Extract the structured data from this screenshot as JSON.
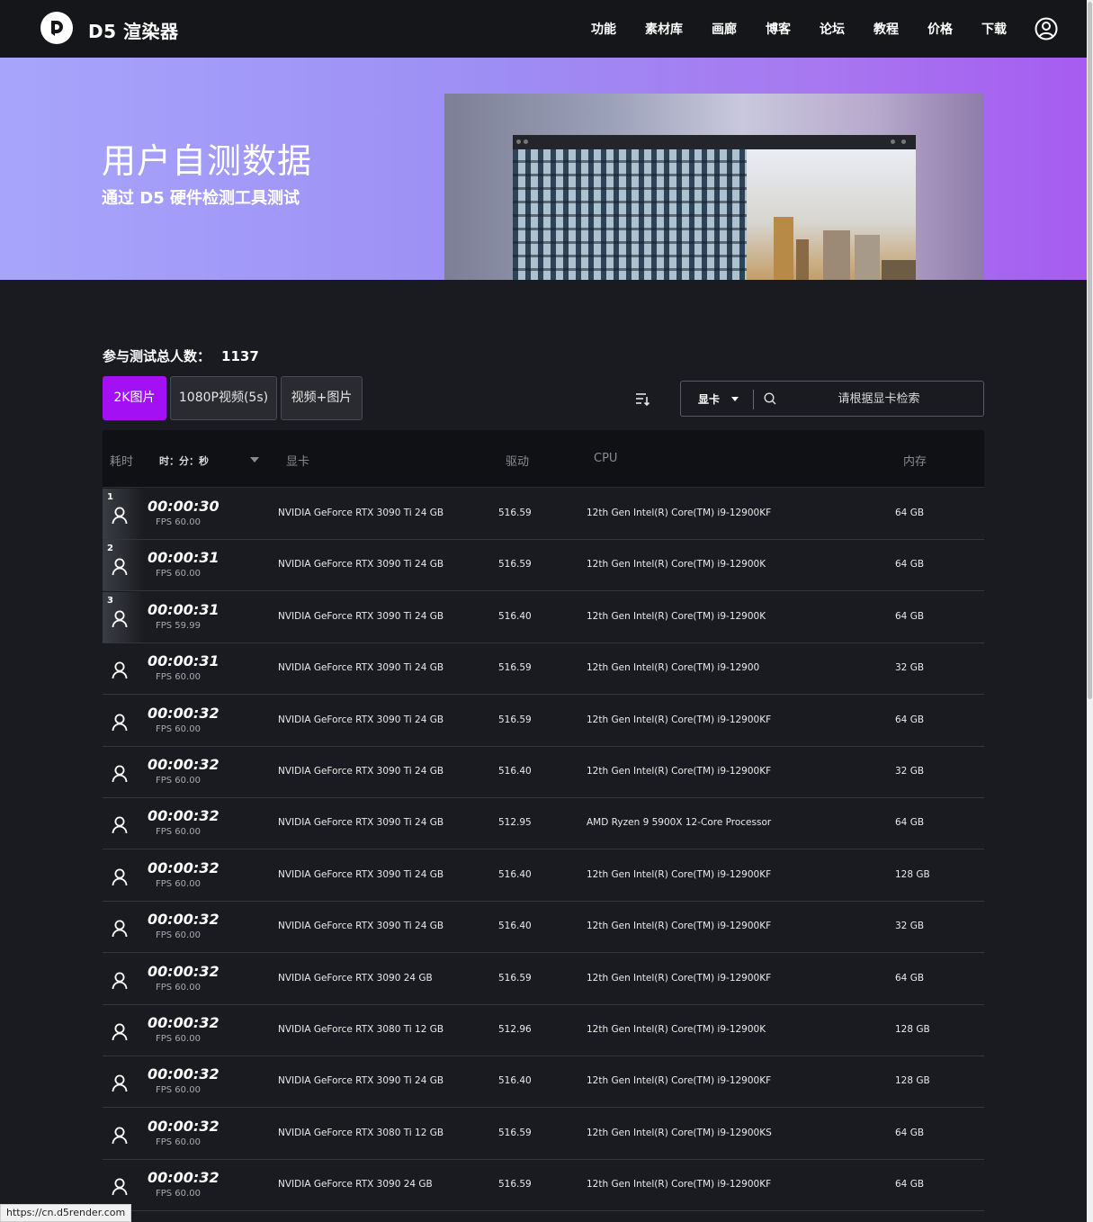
{
  "nav": {
    "brand": "D5 渲染器",
    "links": [
      "功能",
      "素材库",
      "画廊",
      "博客",
      "论坛",
      "教程",
      "价格",
      "下载"
    ]
  },
  "hero": {
    "title": "用户自测数据",
    "subtitle": "通过 D5 硬件检测工具测试"
  },
  "stats": {
    "total_label": "参与测试总人数：",
    "total_value": "1137"
  },
  "tabs": [
    "2K图片",
    "1080P视频(5s)",
    "视频+图片"
  ],
  "active_tab": 0,
  "search": {
    "select_label": "显卡",
    "placeholder": "请根据显卡检索"
  },
  "table": {
    "headers": {
      "time": "耗时",
      "time_format": "时：分：秒",
      "gpu": "显卡",
      "driver": "驱动",
      "cpu": "CPU",
      "ram": "内存"
    },
    "rows": [
      {
        "rank": "1",
        "time": "00:00:30",
        "fps": "FPS 60.00",
        "gpu": "NVIDIA GeForce RTX 3090 Ti 24 GB",
        "driver": "516.59",
        "cpu": "12th Gen Intel(R) Core(TM) i9-12900KF",
        "ram": "64 GB"
      },
      {
        "rank": "2",
        "time": "00:00:31",
        "fps": "FPS 60.00",
        "gpu": "NVIDIA GeForce RTX 3090 Ti 24 GB",
        "driver": "516.59",
        "cpu": "12th Gen Intel(R) Core(TM) i9-12900K",
        "ram": "64 GB"
      },
      {
        "rank": "3",
        "time": "00:00:31",
        "fps": "FPS 59.99",
        "gpu": "NVIDIA GeForce RTX 3090 Ti 24 GB",
        "driver": "516.40",
        "cpu": "12th Gen Intel(R) Core(TM) i9-12900K",
        "ram": "64 GB"
      },
      {
        "rank": "",
        "time": "00:00:31",
        "fps": "FPS 60.00",
        "gpu": "NVIDIA GeForce RTX 3090 Ti 24 GB",
        "driver": "516.59",
        "cpu": "12th Gen Intel(R) Core(TM) i9-12900",
        "ram": "32 GB"
      },
      {
        "rank": "",
        "time": "00:00:32",
        "fps": "FPS 60.00",
        "gpu": "NVIDIA GeForce RTX 3090 Ti 24 GB",
        "driver": "516.59",
        "cpu": "12th Gen Intel(R) Core(TM) i9-12900KF",
        "ram": "64 GB"
      },
      {
        "rank": "",
        "time": "00:00:32",
        "fps": "FPS 60.00",
        "gpu": "NVIDIA GeForce RTX 3090 Ti 24 GB",
        "driver": "516.40",
        "cpu": "12th Gen Intel(R) Core(TM) i9-12900KF",
        "ram": "32 GB"
      },
      {
        "rank": "",
        "time": "00:00:32",
        "fps": "FPS 60.00",
        "gpu": "NVIDIA GeForce RTX 3090 Ti 24 GB",
        "driver": "512.95",
        "cpu": "AMD Ryzen 9 5900X 12-Core Processor",
        "ram": "64 GB"
      },
      {
        "rank": "",
        "time": "00:00:32",
        "fps": "FPS 60.00",
        "gpu": "NVIDIA GeForce RTX 3090 Ti 24 GB",
        "driver": "516.40",
        "cpu": "12th Gen Intel(R) Core(TM) i9-12900KF",
        "ram": "128 GB"
      },
      {
        "rank": "",
        "time": "00:00:32",
        "fps": "FPS 60.00",
        "gpu": "NVIDIA GeForce RTX 3090 Ti 24 GB",
        "driver": "516.40",
        "cpu": "12th Gen Intel(R) Core(TM) i9-12900KF",
        "ram": "32 GB"
      },
      {
        "rank": "",
        "time": "00:00:32",
        "fps": "FPS 60.00",
        "gpu": "NVIDIA GeForce RTX 3090 24 GB",
        "driver": "516.59",
        "cpu": "12th Gen Intel(R) Core(TM) i9-12900KF",
        "ram": "64 GB"
      },
      {
        "rank": "",
        "time": "00:00:32",
        "fps": "FPS 60.00",
        "gpu": "NVIDIA GeForce RTX 3080 Ti 12 GB",
        "driver": "512.96",
        "cpu": "12th Gen Intel(R) Core(TM) i9-12900K",
        "ram": "128 GB"
      },
      {
        "rank": "",
        "time": "00:00:32",
        "fps": "FPS 60.00",
        "gpu": "NVIDIA GeForce RTX 3090 Ti 24 GB",
        "driver": "516.40",
        "cpu": "12th Gen Intel(R) Core(TM) i9-12900KF",
        "ram": "128 GB"
      },
      {
        "rank": "",
        "time": "00:00:32",
        "fps": "FPS 60.00",
        "gpu": "NVIDIA GeForce RTX 3080 Ti 12 GB",
        "driver": "516.59",
        "cpu": "12th Gen Intel(R) Core(TM) i9-12900KS",
        "ram": "64 GB"
      },
      {
        "rank": "",
        "time": "00:00:32",
        "fps": "FPS 60.00",
        "gpu": "NVIDIA GeForce RTX 3090 24 GB",
        "driver": "516.59",
        "cpu": "12th Gen Intel(R) Core(TM) i9-12900KF",
        "ram": "64 GB"
      }
    ]
  },
  "status_url": "https://cn.d5render.com",
  "colors": {
    "accent": "#a410f4",
    "nav_bg": "#151619",
    "page_bg": "#1a1b20"
  }
}
